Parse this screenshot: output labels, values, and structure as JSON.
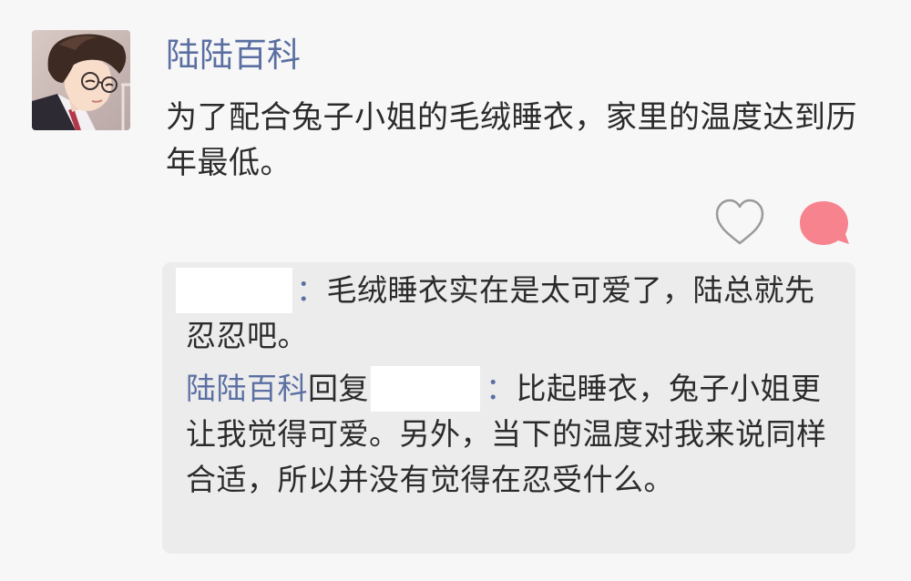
{
  "post": {
    "author": "陆陆百科",
    "text": "为了配合兔子小姐的毛绒睡衣，家里的温度达到历年最低。",
    "avatar_icon": "portrait-man-glasses-icon",
    "actions": {
      "like_icon": "heart-outline-icon",
      "comment_icon": "speech-bubble-icon",
      "comment_color": "#f7838f"
    }
  },
  "comments": [
    {
      "commenter": "",
      "separator": "：",
      "text": "毛绒睡衣实在是太可爱了，陆总就先忍忍吧。"
    },
    {
      "commenter": "陆陆百科",
      "reply_word": "回复",
      "reply_to": "",
      "separator": "：",
      "text": "比起睡衣，兔子小姐更让我觉得可爱。另外，当下的温度对我来说同样合适，所以并没有觉得在忍受什么。"
    }
  ],
  "colors": {
    "name_blue": "#5b6fa2",
    "background": "#f7f7f7",
    "comment_box": "#ececec"
  }
}
